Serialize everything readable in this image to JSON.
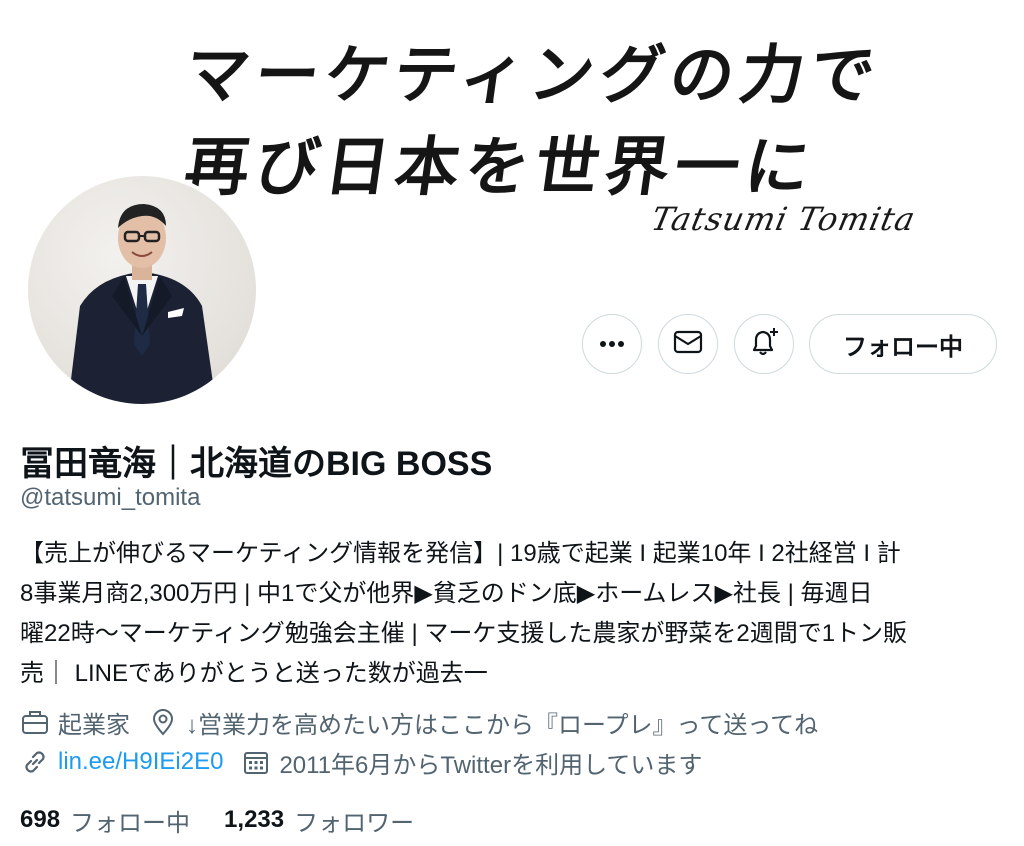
{
  "banner": {
    "line1": "マーケティングの力で",
    "line2": "再び日本を世界一に",
    "signature": "Tatsumi Tomita"
  },
  "profile": {
    "name": "冨田竜海｜北海道のBIG BOSS",
    "handle": "@tatsumi_tomita",
    "bio_lines": [
      "【売上が伸びるマーケティング情報を発信】| 19歳で起業 I 起業10年 I 2社経営 I 計",
      "8事業月商2,300万円 | 中1で父が他界▶貧乏のドン底▶ホームレス▶社長 | 毎週日",
      "曜22時～マーケティング勉強会主催 | マーケ支援した農家が野菜を2週間で1トン販",
      "売｜ LINEでありがとうと送った数が過去一"
    ],
    "profession": "起業家",
    "location": "↓営業力を高めたい方はここから『ロープレ』って送ってね",
    "link": "lin.ee/H9IEi2E0",
    "joined": "2011年6月からTwitterを利用しています"
  },
  "actions": {
    "more_icon": "more-dots-icon",
    "mail_icon": "mail-icon",
    "bell_icon": "bell-plus-icon",
    "follow_label": "フォロー中"
  },
  "stats": {
    "following_count": "698",
    "following_label": "フォロー中",
    "followers_count": "1,233",
    "followers_label": "フォロワー"
  },
  "colors": {
    "text": "#0f1419",
    "secondary": "#536471",
    "link": "#1d9bf0",
    "border": "#cfd9de"
  }
}
